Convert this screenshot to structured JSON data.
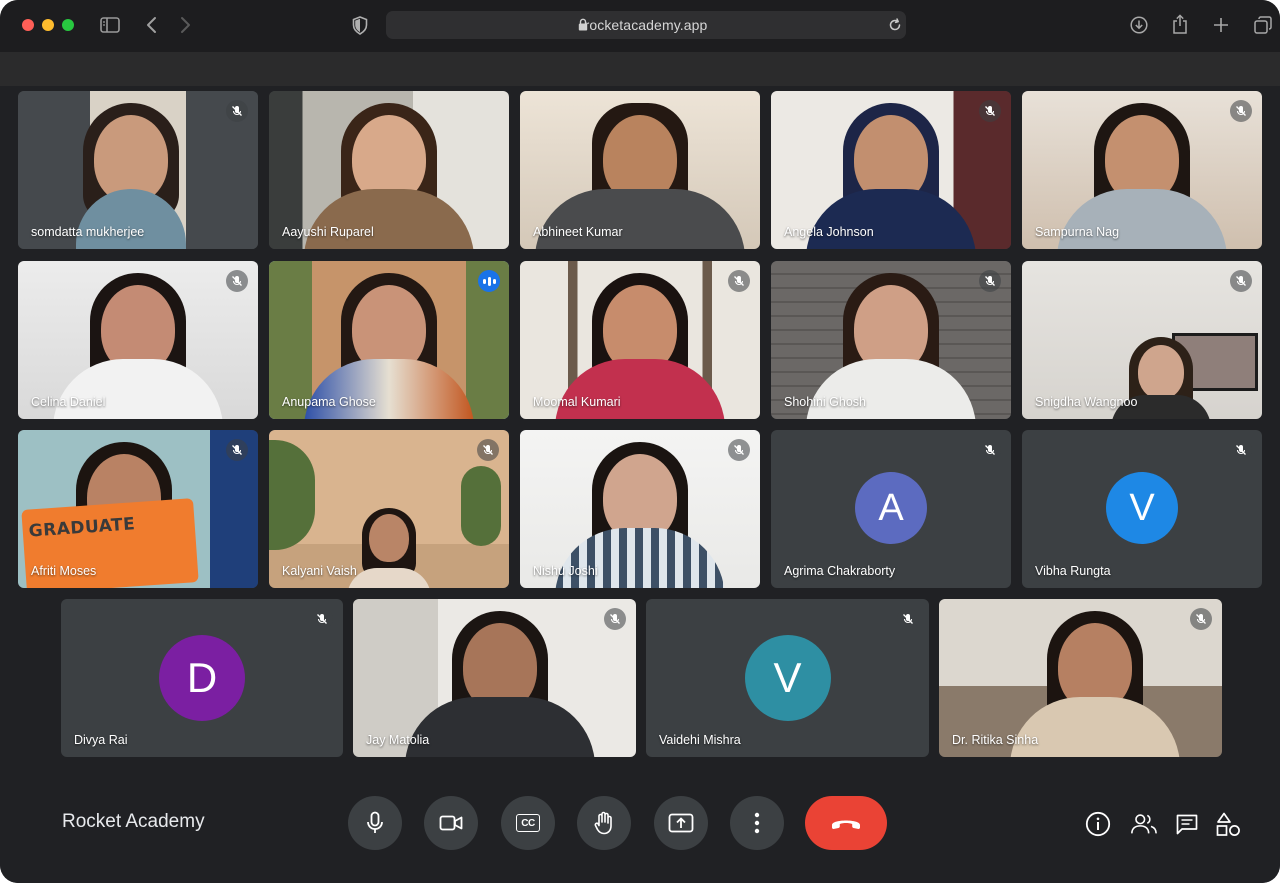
{
  "browser": {
    "url": "rocketacademy.app"
  },
  "meeting": {
    "title": "Rocket Academy"
  },
  "participants": [
    {
      "name": "somdatta mukherjee",
      "muted": true
    },
    {
      "name": "Aayushi Ruparel",
      "muted": false
    },
    {
      "name": "Abhineet Kumar",
      "muted": false
    },
    {
      "name": "Angela Johnson",
      "muted": true
    },
    {
      "name": "Sampurna Nag",
      "muted": true
    },
    {
      "name": "Celina Daniel",
      "muted": true
    },
    {
      "name": "Anupama Ghose",
      "muted": false,
      "speaking": true
    },
    {
      "name": "Moomal Kumari",
      "muted": true
    },
    {
      "name": "Shohini Ghosh",
      "muted": true
    },
    {
      "name": "Snigdha Wangnoo",
      "muted": true
    },
    {
      "name": "Afriti Moses",
      "muted": true
    },
    {
      "name": "Kalyani Vaish",
      "muted": true
    },
    {
      "name": "Nishu Joshi",
      "muted": true
    },
    {
      "name": "Agrima Chakraborty",
      "muted": true,
      "avatar_letter": "A",
      "avatar_color": "#5c6bc0"
    },
    {
      "name": "Vibha Rungta",
      "muted": true,
      "avatar_letter": "V",
      "avatar_color": "#1e88e5"
    },
    {
      "name": "Divya Rai",
      "muted": true,
      "avatar_letter": "D",
      "avatar_color": "#7b1fa2"
    },
    {
      "name": "Jay Matolia",
      "muted": true
    },
    {
      "name": "Vaidehi Mishra",
      "muted": true,
      "avatar_letter": "V",
      "avatar_color": "#2e8fa3"
    },
    {
      "name": "Dr. Ritika Sinha",
      "muted": true
    }
  ],
  "tile_text": {
    "shirt_text": "GRADUATE"
  },
  "controls": [
    {
      "id": "mic",
      "icon": "microphone-icon"
    },
    {
      "id": "camera",
      "icon": "camera-icon"
    },
    {
      "id": "captions",
      "icon": "closed-captions-icon",
      "label": "CC"
    },
    {
      "id": "raise-hand",
      "icon": "hand-icon"
    },
    {
      "id": "present",
      "icon": "present-screen-icon"
    },
    {
      "id": "more",
      "icon": "more-vertical-icon"
    },
    {
      "id": "leave",
      "icon": "end-call-icon",
      "color": "#ea4335"
    }
  ],
  "side_controls": [
    {
      "id": "info",
      "icon": "info-icon"
    },
    {
      "id": "people",
      "icon": "people-icon"
    },
    {
      "id": "chat",
      "icon": "chat-icon"
    },
    {
      "id": "activities",
      "icon": "activities-icon"
    }
  ],
  "colors": {
    "speaking_outline": "#8ab4f8",
    "end_call": "#ea4335",
    "control_bg": "#3c4043",
    "stage_bg": "#202124"
  }
}
